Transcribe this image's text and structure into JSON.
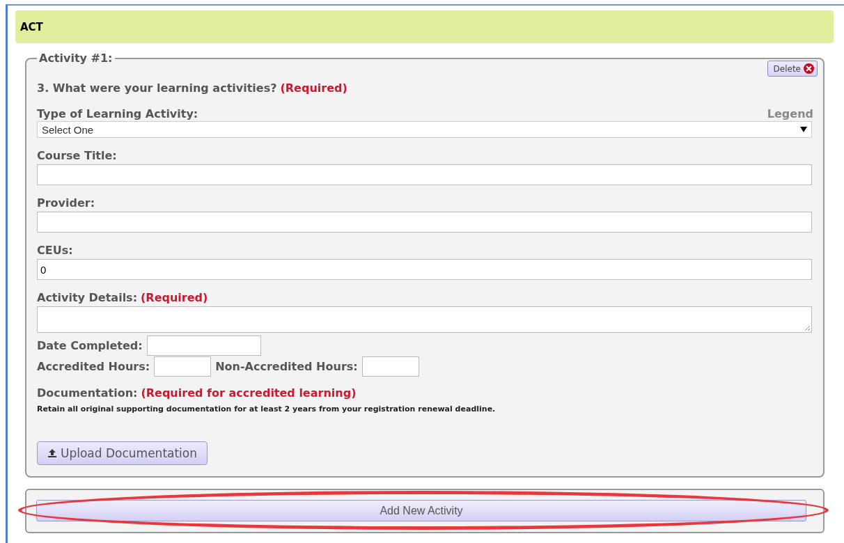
{
  "section": {
    "title": "ACT"
  },
  "activity": {
    "legend": "Activity #1:",
    "delete_button": "Delete",
    "question": {
      "text": "3. What were your learning activities?",
      "required": "(Required)"
    },
    "fields": [
      {
        "kind": "select",
        "label": "Type of Learning Activity:",
        "aside": "Legend",
        "value": "Select One"
      },
      {
        "kind": "text",
        "label": "Course Title:"
      },
      {
        "kind": "text",
        "label": "Provider:"
      },
      {
        "kind": "text",
        "label": "CEUs:",
        "value": "0"
      },
      {
        "kind": "textarea",
        "label": "Activity Details:",
        "required": "(Required)"
      }
    ],
    "date_completed": {
      "label": "Date Completed:"
    },
    "accredited_hours": {
      "label": "Accredited Hours:"
    },
    "non_accredited_hours": {
      "label": "Non-Accredited Hours:"
    },
    "documentation": {
      "label": "Documentation:",
      "required": "(Required for accredited learning)",
      "note": "Retain all original supporting documentation for at least 2 years from your registration renewal deadline.",
      "upload_button": "Upload Documentation"
    }
  },
  "add_button": {
    "label": "Add New Activity",
    "highlighted": true
  }
}
